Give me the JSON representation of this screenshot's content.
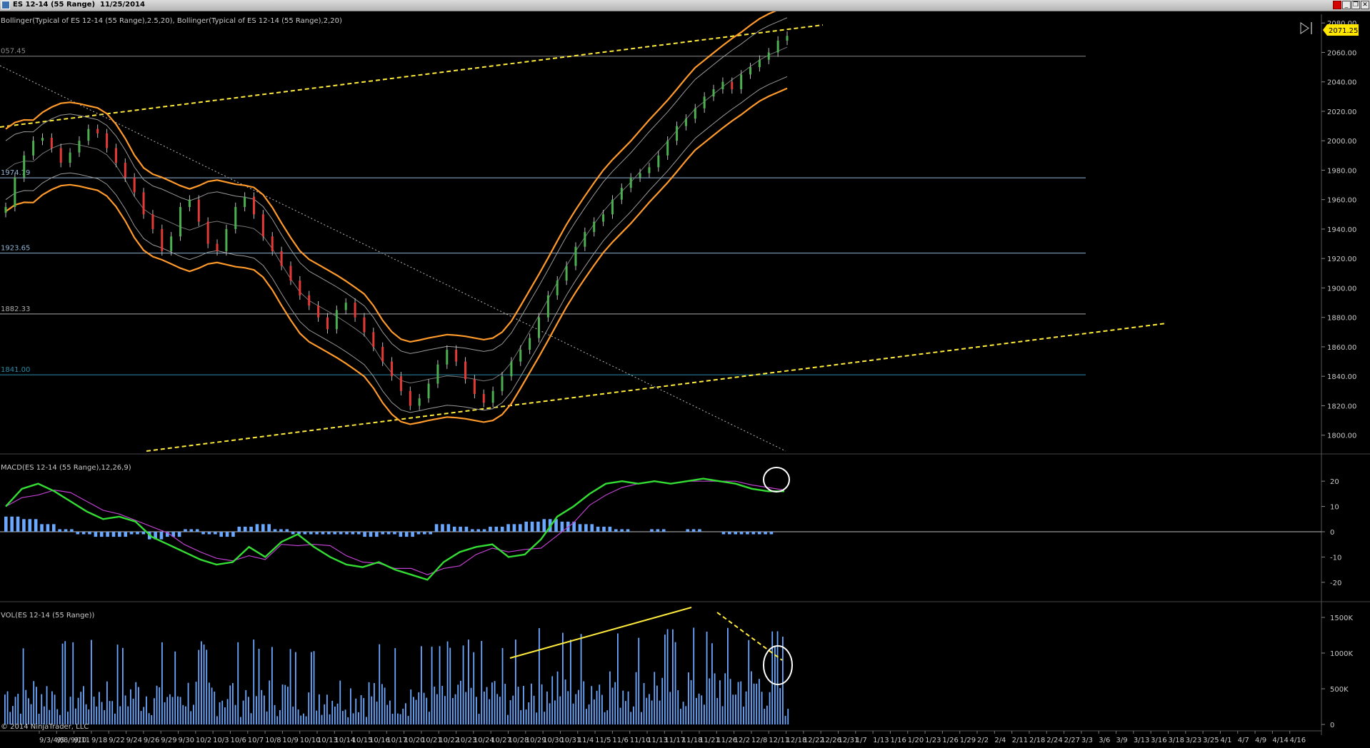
{
  "window": {
    "title": "ES 12-14 (55 Range)  11/25/2014",
    "buttons": [
      "red-square",
      "minimize",
      "restore",
      "close"
    ]
  },
  "copyright": "© 2014 NinjaTrader, LLC",
  "price_panel": {
    "indicator_label": "Bollinger(Typical of ES 12-14 (55 Range),2.5,20), Bollinger(Typical of ES 12-14 (55 Range),2,20)",
    "current_price": "2071.25",
    "y_ticks": [
      "2080.00",
      "2060.00",
      "2040.00",
      "2020.00",
      "2000.00",
      "1980.00",
      "1960.00",
      "1940.00",
      "1920.00",
      "1900.00",
      "1880.00",
      "1860.00",
      "1840.00",
      "1820.00",
      "1800.00"
    ],
    "levels": [
      "057.45",
      "1974.79",
      "1923.65",
      "1882.33",
      "1841.00"
    ]
  },
  "macd_panel": {
    "label": "MACD(ES 12-14 (55 Range),12,26,9)",
    "y_ticks": [
      "20",
      "10",
      "0",
      "-10",
      "-20"
    ]
  },
  "volume_panel": {
    "label": "VOL(ES 12-14 (55 Range))",
    "y_ticks": [
      "1500K",
      "1000K",
      "500K",
      "0"
    ]
  },
  "x_axis": {
    "labels": [
      "9/3/4/5",
      "9/8/9/10",
      "9/11",
      "9/18",
      "9/22",
      "9/24",
      "9/26",
      "9/29",
      "9/30",
      "10/2",
      "10/3",
      "10/6",
      "10/7",
      "10/8",
      "10/9",
      "10/10",
      "10/13",
      "10/14",
      "10/15",
      "10/16",
      "10/17",
      "10/20",
      "10/21",
      "10/22",
      "10/23",
      "10/24",
      "10/27",
      "10/28",
      "10/29",
      "10/30",
      "10/31",
      "11/4",
      "11/5",
      "11/6",
      "11/10",
      "11/13",
      "11/17",
      "11/18",
      "11/21",
      "11/26",
      "12/2",
      "12/8",
      "12/11",
      "12/18",
      "12/22",
      "12/26",
      "12/31",
      "1/7",
      "1/13",
      "1/16",
      "1/20",
      "1/23",
      "1/26",
      "1/29",
      "2/2",
      "2/4",
      "2/11",
      "2/18",
      "2/24",
      "2/27",
      "3/3",
      "3/6",
      "3/9",
      "3/13",
      "3/16",
      "3/18",
      "3/23",
      "3/25",
      "4/1",
      "4/7",
      "4/9",
      "4/14",
      "4/16"
    ]
  },
  "chart_data": {
    "type": "candlestick",
    "instrument": "ES 12-14 (55 Range)",
    "price_ylim": [
      1795,
      2083
    ],
    "close_approx": [
      1955,
      1975,
      1990,
      2000,
      2002,
      1995,
      1985,
      1992,
      2000,
      2008,
      2005,
      1995,
      1985,
      1975,
      1965,
      1950,
      1940,
      1925,
      1935,
      1955,
      1960,
      1945,
      1930,
      1925,
      1940,
      1955,
      1962,
      1950,
      1935,
      1925,
      1915,
      1905,
      1895,
      1888,
      1880,
      1872,
      1885,
      1890,
      1880,
      1870,
      1860,
      1850,
      1840,
      1830,
      1820,
      1825,
      1835,
      1848,
      1858,
      1850,
      1838,
      1828,
      1822,
      1830,
      1840,
      1850,
      1858,
      1866,
      1880,
      1895,
      1905,
      1915,
      1928,
      1938,
      1945,
      1950,
      1960,
      1968,
      1975,
      1978,
      1982,
      1990,
      2000,
      2010,
      2015,
      2022,
      2030,
      2035,
      2040,
      2035,
      2045,
      2050,
      2055,
      2060,
      2068,
      2071.25
    ],
    "macd_ylim": [
      -22,
      24
    ],
    "macd_approx": [
      10,
      17,
      19,
      16,
      12,
      8,
      5,
      6,
      4,
      -2,
      -5,
      -8,
      -11,
      -13,
      -12,
      -6,
      -10,
      -4,
      -1,
      -6,
      -10,
      -13,
      -14,
      -12,
      -15,
      -17,
      -19,
      -12,
      -8,
      -6,
      -5,
      -10,
      -9,
      -3,
      6,
      10,
      15,
      19,
      20,
      19,
      20,
      19,
      20,
      21,
      20,
      19,
      17,
      16,
      16
    ],
    "macd_hist_approx": [
      6,
      5,
      3,
      1,
      -1,
      -2,
      -2,
      -1,
      -3,
      -2,
      1,
      -1,
      -2,
      2,
      3,
      1,
      -1,
      -1,
      -1,
      -1,
      -2,
      -1,
      -2,
      -1,
      3,
      2,
      1,
      2,
      3,
      4,
      5,
      4,
      3,
      2,
      1,
      0,
      1,
      0,
      1,
      0,
      -1,
      -1,
      -1
    ],
    "volume_ylim": [
      0,
      1600000
    ]
  }
}
